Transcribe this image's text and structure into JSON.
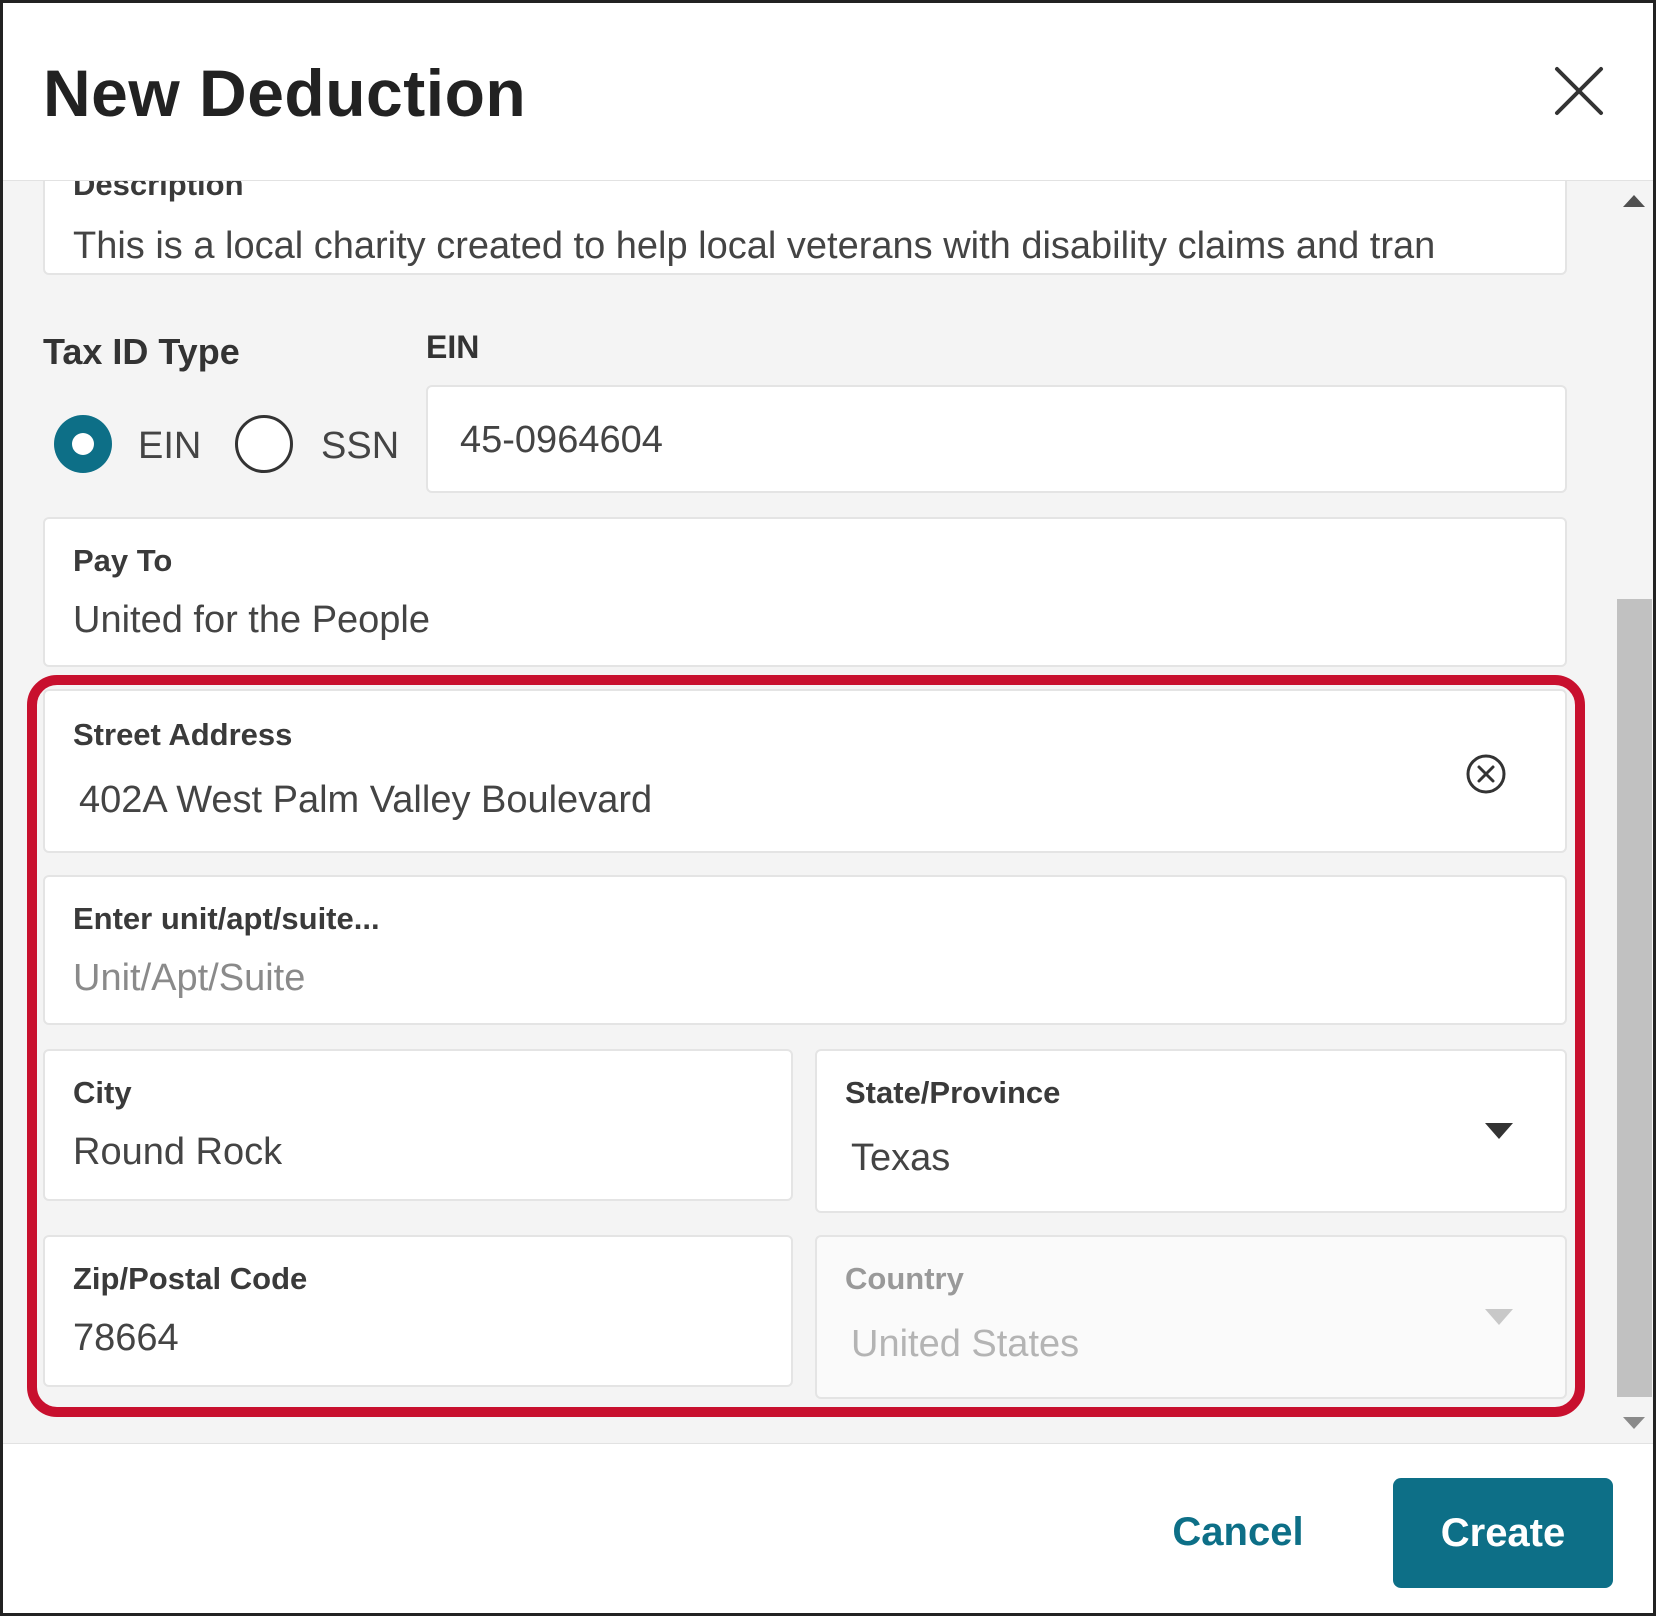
{
  "dialog": {
    "title": "New Deduction"
  },
  "description": {
    "label": "Description",
    "value": "This is a local charity created to help local veterans with disability claims and tran"
  },
  "tax_id_type": {
    "label": "Tax ID Type",
    "options": [
      {
        "label": "EIN",
        "selected": true
      },
      {
        "label": "SSN",
        "selected": false
      }
    ]
  },
  "ein": {
    "label": "EIN",
    "value": "45-0964604"
  },
  "pay_to": {
    "label": "Pay To",
    "value": "United for the People"
  },
  "street_address": {
    "label": "Street Address",
    "value": "402A West Palm Valley Boulevard",
    "clear_icon": "circle-x-icon"
  },
  "unit": {
    "label": "Enter unit/apt/suite...",
    "placeholder": "Unit/Apt/Suite"
  },
  "city": {
    "label": "City",
    "value": "Round Rock"
  },
  "state": {
    "label": "State/Province",
    "value": "Texas"
  },
  "zip": {
    "label": "Zip/Postal Code",
    "value": "78664"
  },
  "country": {
    "label": "Country",
    "value": "United States",
    "disabled": true
  },
  "footer": {
    "cancel_label": "Cancel",
    "create_label": "Create"
  },
  "colors": {
    "accent": "#0d6f87",
    "highlight": "#c8102e"
  }
}
